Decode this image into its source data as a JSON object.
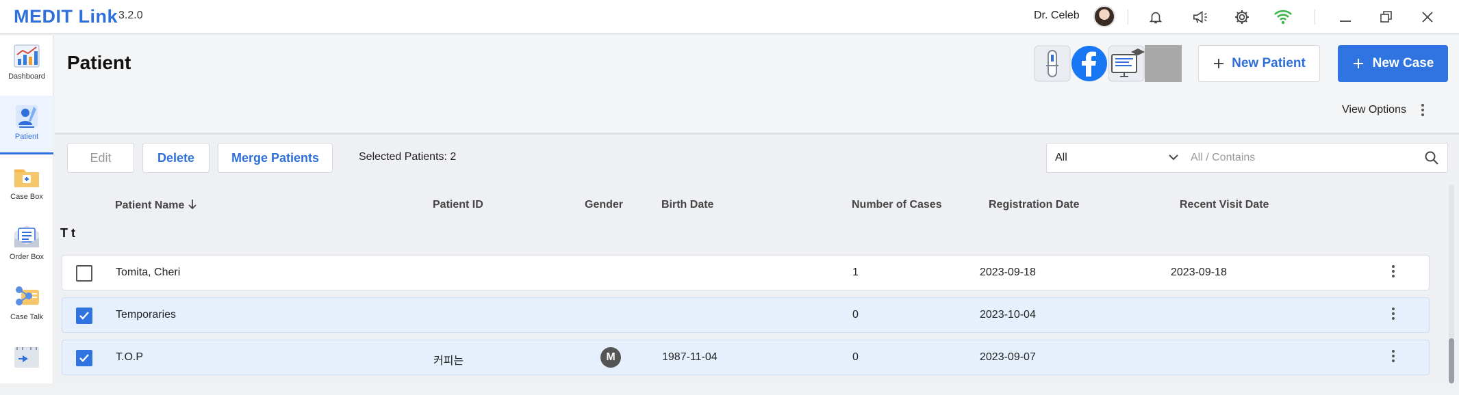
{
  "app": {
    "logo": "MEDIT Link",
    "version": "3.2.0",
    "user": "Dr. Celeb"
  },
  "titlebar": {
    "icons": [
      "bell-icon",
      "megaphone-icon",
      "gear-icon",
      "wifi-icon",
      "minimize-icon",
      "restore-icon",
      "close-icon"
    ]
  },
  "sidebar": {
    "items": [
      {
        "label": "Dashboard",
        "icon": "dashboard-chart-icon"
      },
      {
        "label": "Patient",
        "icon": "patient-icon",
        "active": true
      },
      {
        "label": "Case Box",
        "icon": "case-box-icon"
      },
      {
        "label": "Order Box",
        "icon": "order-box-icon"
      },
      {
        "label": "Case Talk",
        "icon": "case-talk-icon"
      },
      {
        "label": "",
        "icon": "work-box-icon"
      }
    ]
  },
  "header": {
    "title": "Patient",
    "new_patient": "New Patient",
    "new_case": "New Case",
    "view_options": "View Options"
  },
  "toolbar": {
    "edit": "Edit",
    "delete": "Delete",
    "merge": "Merge Patients",
    "selected": "Selected Patients: 2",
    "filter_value": "All",
    "search_placeholder": "All / Contains"
  },
  "table": {
    "columns": {
      "name": "Patient Name",
      "id": "Patient ID",
      "gender": "Gender",
      "birth": "Birth Date",
      "cases": "Number of Cases",
      "registration": "Registration Date",
      "recent": "Recent Visit Date"
    },
    "group_label": "T t",
    "rows": [
      {
        "name": "Tomita, Cheri",
        "id": "",
        "gender": "",
        "birth": "",
        "cases": "1",
        "registration": "2023-09-18",
        "recent": "2023-09-18",
        "checked": false
      },
      {
        "name": "Temporaries",
        "id": "",
        "gender": "",
        "birth": "",
        "cases": "0",
        "registration": "2023-10-04",
        "recent": "",
        "checked": true
      },
      {
        "name": "T.O.P",
        "id": "커피는",
        "gender": "M",
        "birth": "1987-11-04",
        "cases": "0",
        "registration": "2023-09-07",
        "recent": "",
        "checked": true
      }
    ]
  },
  "colors": {
    "accent": "#2f74e0",
    "selected_row": "#e6f0fc",
    "wifi": "#3bb54a"
  }
}
